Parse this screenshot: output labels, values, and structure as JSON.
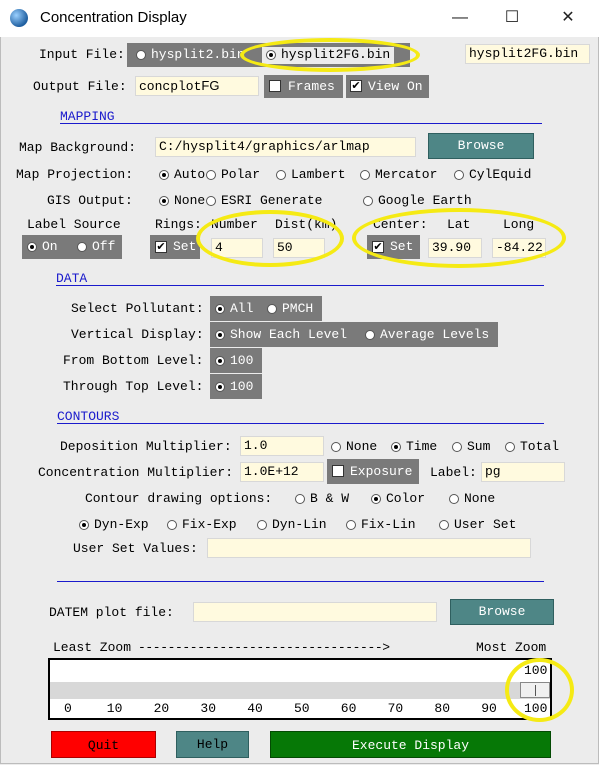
{
  "window": {
    "title": "Concentration Display",
    "min": "—",
    "max": "☐",
    "close": "✕"
  },
  "input_file": {
    "label": "Input File:",
    "options": [
      "hysplit2.bin",
      "hysplit2FG.bin"
    ],
    "selected": "hysplit2FG.bin",
    "value": "hysplit2FG.bin"
  },
  "output_file": {
    "label": "Output File:",
    "value": "concplot",
    "suffix": "FG",
    "frames_label": "Frames",
    "frames_checked": false,
    "viewon_label": "View On",
    "viewon_checked": true
  },
  "mapping": {
    "section": "MAPPING",
    "background_label": "Map Background:",
    "background_value": "C:/hysplit4/graphics/arlmap",
    "browse": "Browse",
    "projection_label": "Map Projection:",
    "projection_options": [
      "Auto",
      "Polar",
      "Lambert",
      "Mercator",
      "CylEquid"
    ],
    "projection_selected": "Auto",
    "gis_label": "GIS Output:",
    "gis_options": [
      "None",
      "ESRI Generate",
      "Google Earth"
    ],
    "gis_selected": "None",
    "label_source": "Label Source",
    "label_on": "On",
    "label_off": "Off",
    "label_selected": "On",
    "rings": "Rings:",
    "number": "Number",
    "dist": "Dist(km)",
    "rings_set": "Set",
    "rings_checked": true,
    "number_value": "4",
    "dist_value": "50",
    "center": "Center:",
    "lat": "Lat",
    "long": "Long",
    "center_set": "Set",
    "center_checked": true,
    "lat_value": "39.90",
    "long_value": "-84.22"
  },
  "data": {
    "section": "DATA",
    "pollutant_label": "Select Pollutant:",
    "pollutant_options": [
      "All",
      "PMCH"
    ],
    "pollutant_selected": "All",
    "vertical_label": "Vertical Display:",
    "vertical_options": [
      "Show Each Level",
      "Average Levels"
    ],
    "vertical_selected": "Show Each Level",
    "bottom_label": "From Bottom Level:",
    "bottom_value": "100",
    "top_label": "Through Top Level:",
    "top_value": "100"
  },
  "contours": {
    "section": "CONTOURS",
    "dep_label": "Deposition Multiplier:",
    "dep_value": "1.0",
    "dep_options": [
      "None",
      "Time",
      "Sum",
      "Total"
    ],
    "dep_selected": "Time",
    "conc_label": "Concentration Multiplier:",
    "conc_value": "1.0E+12",
    "exposure_label": "Exposure",
    "exposure_checked": false,
    "units_label": "Label:",
    "units_value": "pg",
    "drawing_label": "Contour drawing options:",
    "drawing_options": [
      "B & W",
      "Color",
      "None"
    ],
    "drawing_selected": "Color",
    "interval_options": [
      "Dyn-Exp",
      "Fix-Exp",
      "Dyn-Lin",
      "Fix-Lin",
      "User Set"
    ],
    "interval_selected": "Dyn-Exp",
    "userset_label": "User Set Values:",
    "userset_value": ""
  },
  "datem": {
    "label": "DATEM plot file:",
    "value": "",
    "browse": "Browse"
  },
  "zoom": {
    "left_label": "Least Zoom",
    "right_label": "Most Zoom",
    "value": "100",
    "ticks": [
      "0",
      "10",
      "20",
      "30",
      "40",
      "50",
      "60",
      "70",
      "80",
      "90",
      "100"
    ],
    "level": 1.0
  },
  "buttons": {
    "quit": "Quit",
    "help": "Help",
    "execute": "Execute Display"
  },
  "colors": {
    "quit": "#ff0000",
    "help": "#4e8686",
    "execute": "#067806",
    "highlight": "#f5ea14",
    "section": "#1a1acc",
    "field": "#fffadf"
  }
}
